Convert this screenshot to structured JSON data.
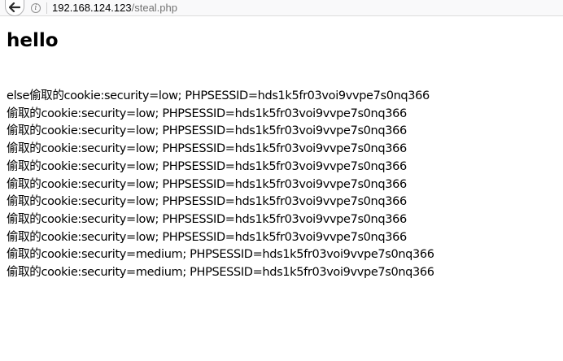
{
  "browser": {
    "url_host": "192.168.124.123",
    "url_path": "/steal.php"
  },
  "page": {
    "heading": "hello",
    "lines": [
      "else偷取的cookie:security=low; PHPSESSID=hds1k5fr03voi9vvpe7s0nq366",
      "偷取的cookie:security=low; PHPSESSID=hds1k5fr03voi9vvpe7s0nq366",
      "偷取的cookie:security=low; PHPSESSID=hds1k5fr03voi9vvpe7s0nq366",
      "偷取的cookie:security=low; PHPSESSID=hds1k5fr03voi9vvpe7s0nq366",
      "偷取的cookie:security=low; PHPSESSID=hds1k5fr03voi9vvpe7s0nq366",
      "偷取的cookie:security=low; PHPSESSID=hds1k5fr03voi9vvpe7s0nq366",
      "偷取的cookie:security=low; PHPSESSID=hds1k5fr03voi9vvpe7s0nq366",
      "偷取的cookie:security=low; PHPSESSID=hds1k5fr03voi9vvpe7s0nq366",
      "偷取的cookie:security=low; PHPSESSID=hds1k5fr03voi9vvpe7s0nq366",
      "偷取的cookie:security=medium; PHPSESSID=hds1k5fr03voi9vvpe7s0nq366",
      "偷取的cookie:security=medium; PHPSESSID=hds1k5fr03voi9vvpe7s0nq366"
    ]
  },
  "icons": {
    "back": "back-arrow-icon",
    "info": "info-icon"
  },
  "colors": {
    "text": "#000000",
    "url_path": "#737373",
    "toolbar_bg": "#f9f9fa"
  }
}
